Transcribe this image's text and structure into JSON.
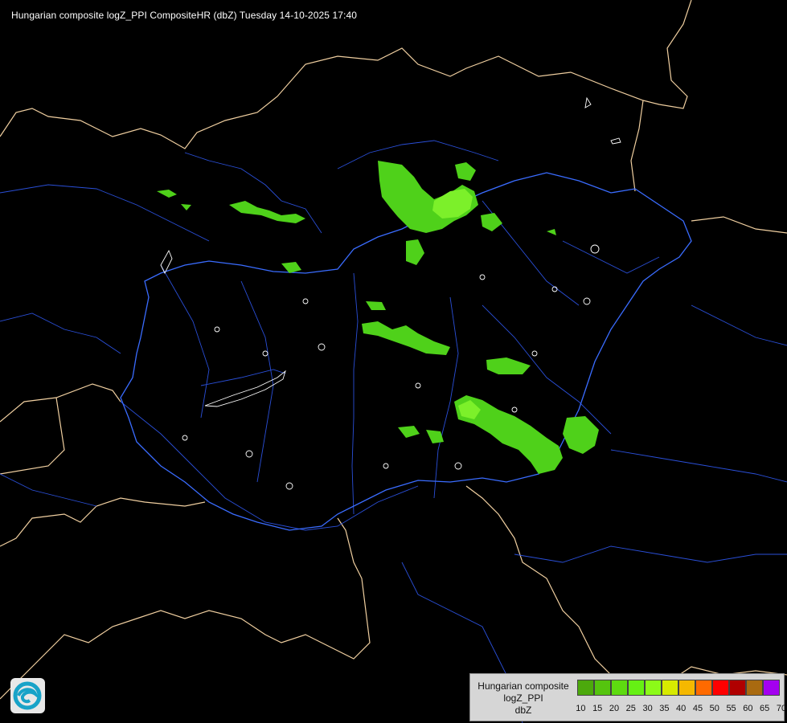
{
  "title": "Hungarian composite logZ_PPI CompositeHR (dbZ) Tuesday 14-10-2025 17:40",
  "colors": {
    "background": "#000000",
    "country_border": "#f0cfa0",
    "hungary_border": "#3a6cff",
    "rivers": "#2a4fd8",
    "lakes": "#ffffff",
    "echo_light": "#4fd11a",
    "echo_bright": "#7cf02a"
  },
  "legend": {
    "line1": "Hungarian composite",
    "line2": "logZ_PPI",
    "line3": "dbZ",
    "scale": [
      {
        "value": "10",
        "color": "#4ca90c"
      },
      {
        "value": "15",
        "color": "#55c40e"
      },
      {
        "value": "20",
        "color": "#5edb10"
      },
      {
        "value": "25",
        "color": "#66f014"
      },
      {
        "value": "30",
        "color": "#8cfa18"
      },
      {
        "value": "35",
        "color": "#d7ea00"
      },
      {
        "value": "40",
        "color": "#f5b800"
      },
      {
        "value": "45",
        "color": "#ff6a00"
      },
      {
        "value": "50",
        "color": "#ff0000"
      },
      {
        "value": "55",
        "color": "#b00000"
      },
      {
        "value": "60",
        "color": "#a96a10"
      },
      {
        "value": "65",
        "color": "#a400f0"
      },
      {
        "value": "70",
        "color": "#b8b8ff"
      }
    ],
    "extra_tick": "70"
  },
  "logo_icon": "omsz-logo-icon"
}
